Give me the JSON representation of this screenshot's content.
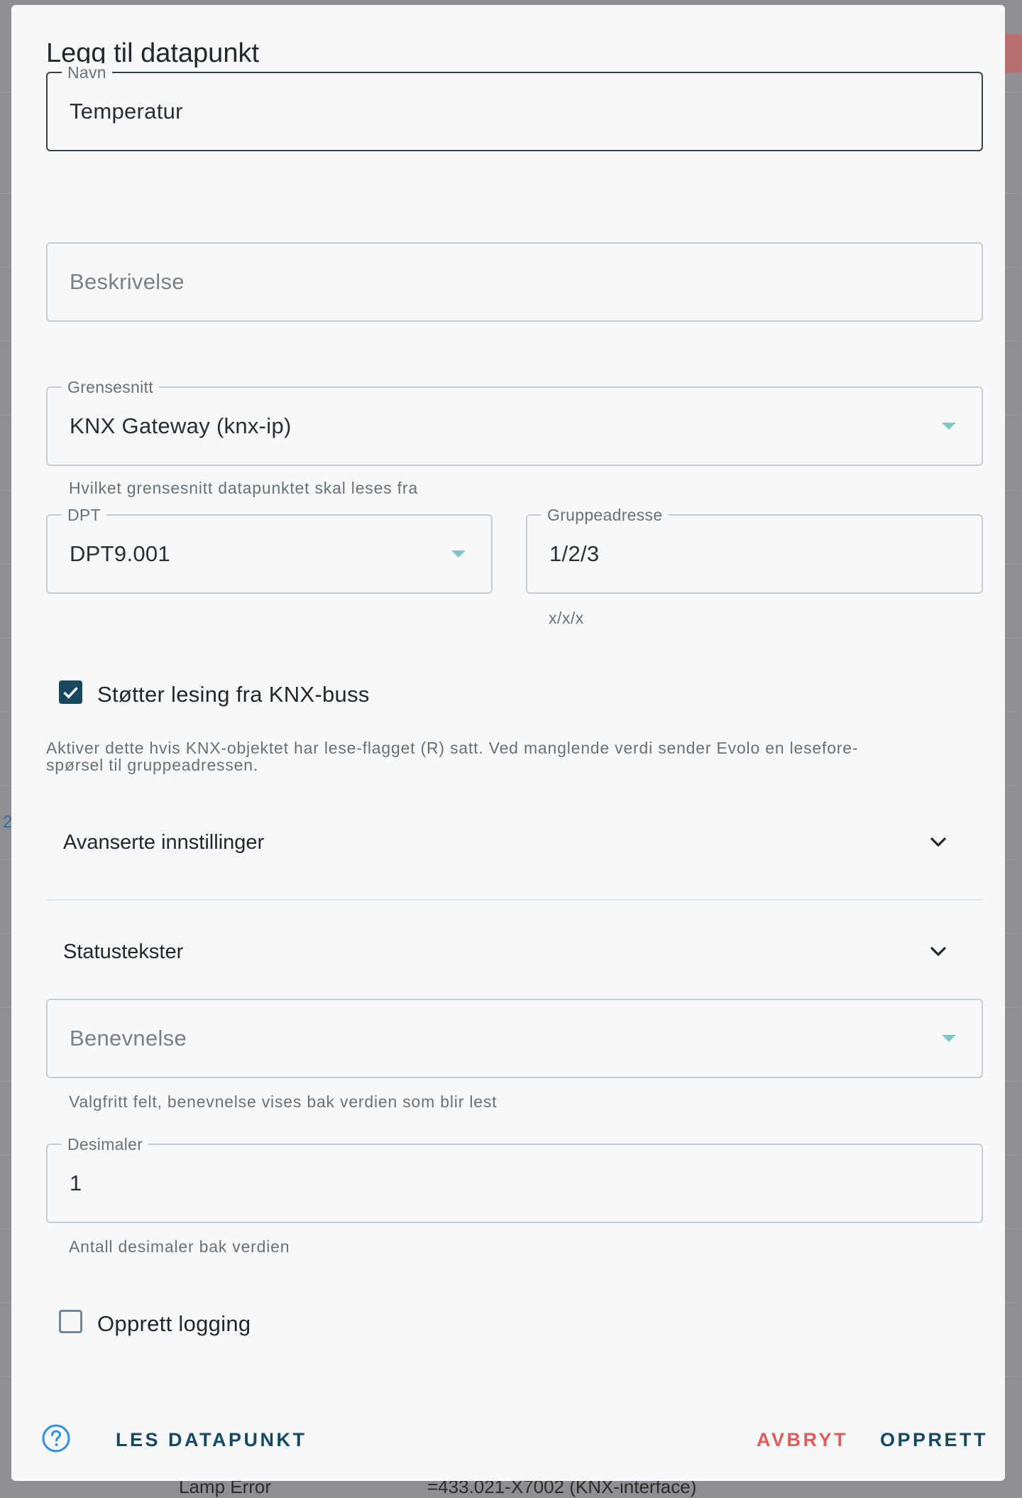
{
  "dialog": {
    "title": "Legg til datapunkt"
  },
  "form": {
    "name": {
      "label": "Navn",
      "value": "Temperatur"
    },
    "description": {
      "placeholder": "Beskrivelse"
    },
    "interface": {
      "label": "Grensesnitt",
      "value": "KNX Gateway (knx-ip)",
      "helper": "Hvilket grensesnitt datapunktet skal leses fra"
    },
    "dpt": {
      "label": "DPT",
      "value": "DPT9.001"
    },
    "group_address": {
      "label": "Gruppeadresse",
      "value": "1/2/3",
      "helper": "x/x/x"
    },
    "read_support": {
      "label": "Støtter lesing fra KNX-buss",
      "checked": true,
      "helper_line1": "Aktiver dette hvis KNX-objektet har lese-flagget (R) satt. Ved manglende verdi sender Evolo en lesefore-",
      "helper_line2": "spørsel til gruppeadressen."
    },
    "advanced": {
      "label": "Avanserte innstillinger"
    },
    "status_texts": {
      "label": "Statustekster"
    },
    "unit": {
      "placeholder": "Benevnelse",
      "helper": "Valgfritt felt, benevnelse vises bak verdien som blir lest"
    },
    "decimals": {
      "label": "Desimaler",
      "value": "1",
      "helper": "Antall desimaler bak verdien"
    },
    "logging": {
      "label": "Opprett logging",
      "checked": false
    }
  },
  "actions": {
    "help_icon": "help-circle-icon",
    "read_label": "LES DATAPUNKT",
    "cancel_label": "AVBRYT",
    "create_label": "OPPRETT"
  },
  "background": {
    "row_text_1": "Lamp Error",
    "row_text_2": "=433.021-X7002 (KNX-interface)",
    "link_fragment": "2"
  },
  "colors": {
    "primary": "#17485f",
    "danger": "#e25a5a",
    "caret": "#7fc7c3"
  }
}
